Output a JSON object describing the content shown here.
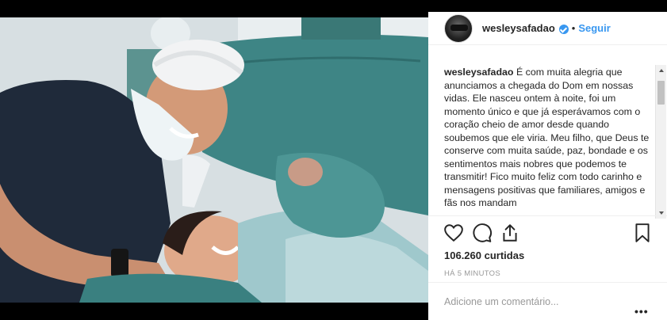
{
  "post": {
    "username": "wesleysafadao",
    "follow_label": "Seguir",
    "separator": "•",
    "caption_username": "wesleysafadao",
    "caption_text": "É com muita alegria que anunciamos a chegada do Dom em nossas vidas. Ele nasceu ontem à noite, foi um momento único e que já esperávamos com o coração cheio de amor desde quando soubemos que ele viria. Meu filho, que Deus te conserve com muita saúde, paz, bondade e os sentimentos mais nobres que podemos te transmitir! Fico muito feliz com todo carinho e mensagens positivas que familiares, amigos e fãs nos mandam",
    "likes": "106.260 curtidas",
    "timestamp": "HÁ 5 MINUTOS",
    "comment_placeholder": "Adicione um comentário...",
    "more_label": "•••",
    "verified": true
  },
  "icons": {
    "like": "heart-icon",
    "comment": "comment-icon",
    "share": "share-icon",
    "save": "bookmark-icon",
    "verified": "verified-icon"
  },
  "colors": {
    "accent": "#3897f0",
    "text": "#262626",
    "muted": "#999999",
    "scrub_teal": "#3f8a8a"
  }
}
